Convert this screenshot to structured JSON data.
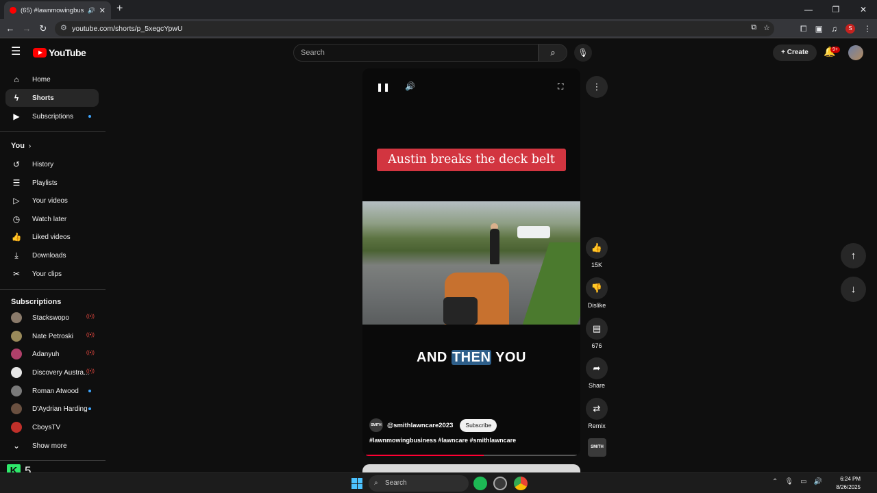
{
  "browser": {
    "tab_title": "(65) #lawnmowingbusiness",
    "url": "youtube.com/shorts/p_5xegcYpwU",
    "profile_initial": "S"
  },
  "header": {
    "logo_text": "YouTube",
    "search_placeholder": "Search",
    "create_label": "Create",
    "notification_count": "9+"
  },
  "sidebar": {
    "main": [
      {
        "label": "Home",
        "icon": "home-icon"
      },
      {
        "label": "Shorts",
        "icon": "shorts-icon",
        "active": true
      },
      {
        "label": "Subscriptions",
        "icon": "subscriptions-icon",
        "dot": true
      }
    ],
    "you_heading": "You",
    "you": [
      {
        "label": "History",
        "icon": "history-icon"
      },
      {
        "label": "Playlists",
        "icon": "playlists-icon"
      },
      {
        "label": "Your videos",
        "icon": "your-videos-icon"
      },
      {
        "label": "Watch later",
        "icon": "watch-later-icon"
      },
      {
        "label": "Liked videos",
        "icon": "liked-videos-icon"
      },
      {
        "label": "Downloads",
        "icon": "downloads-icon"
      },
      {
        "label": "Your clips",
        "icon": "clips-icon"
      }
    ],
    "subscriptions_heading": "Subscriptions",
    "subscriptions": [
      {
        "label": "Stackswopo",
        "indicator": "live",
        "color": "#8a7a6a"
      },
      {
        "label": "Nate Petroski",
        "indicator": "live",
        "color": "#9a8a5a"
      },
      {
        "label": "Adanyuh",
        "indicator": "live",
        "color": "#b0406a"
      },
      {
        "label": "Discovery Austra...",
        "indicator": "live",
        "color": "#e6e6e6"
      },
      {
        "label": "Roman Atwood",
        "indicator": "dot",
        "color": "#7a7a7a"
      },
      {
        "label": "D'Aydrian Harding",
        "indicator": "dot",
        "color": "#6a5040"
      },
      {
        "label": "CboysTV",
        "indicator": "none",
        "color": "#c0302a"
      }
    ],
    "show_more": "Show more"
  },
  "short": {
    "caption_banner": "Austin breaks the deck belt",
    "subtitle_before": "AND ",
    "subtitle_highlight": "THEN",
    "subtitle_after": " YOU",
    "channel_handle": "@smithlawncare2023",
    "channel_logo_text": "SMITH",
    "subscribe_label": "Subscribe",
    "hashtags": "#lawnmowingbusiness #lawncare #smithlawncare",
    "progress": 0.56
  },
  "actions": {
    "like_count": "15K",
    "dislike_label": "Dislike",
    "comment_count": "676",
    "share_label": "Share",
    "remix_label": "Remix",
    "audio_thumb_text": "SMITH"
  },
  "taskbar": {
    "k_badge": "5",
    "search_placeholder": "Search",
    "time": "6:24 PM",
    "date": "8/26/2025"
  },
  "colors": {
    "accent_red": "#ff0000",
    "banner_red": "#d23540",
    "subtitle_highlight": "#2e5f8a"
  }
}
